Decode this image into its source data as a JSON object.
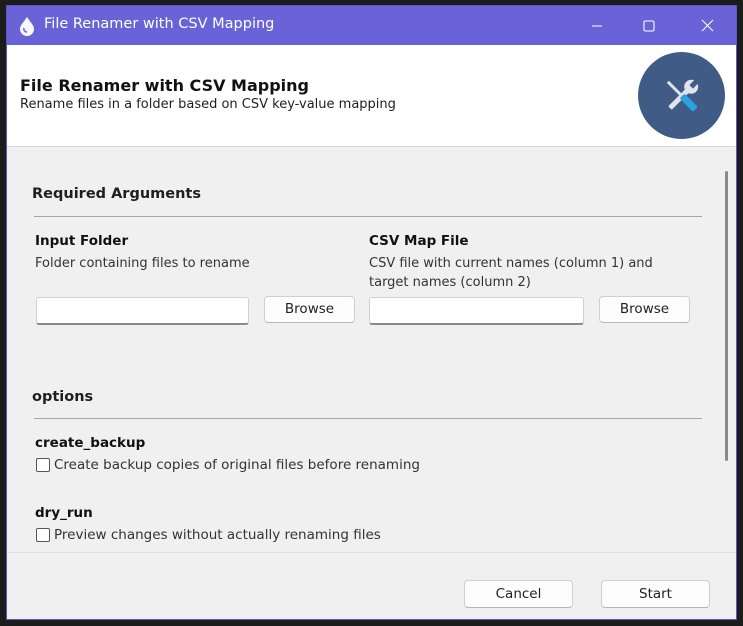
{
  "window": {
    "title": "File Renamer with CSV Mapping",
    "icon": "app-drop-icon",
    "controls": [
      "minimize-icon",
      "maximize-icon",
      "close-icon"
    ]
  },
  "header": {
    "title": "File Renamer with CSV Mapping",
    "subtitle": "Rename files in a folder based on CSV key-value mapping",
    "logo_icon": "tools-icon"
  },
  "required": {
    "section_title": "Required Arguments",
    "input_folder": {
      "label": "Input Folder",
      "description": "Folder containing files to rename",
      "value": "",
      "browse_label": "Browse"
    },
    "csv_map": {
      "label": "CSV Map File",
      "description": "CSV file with current names (column 1) and target names (column 2)",
      "value": "",
      "browse_label": "Browse"
    }
  },
  "options": {
    "section_title": "options",
    "create_backup": {
      "label": "create_backup",
      "checkbox_label": "Create backup copies of original files before renaming",
      "checked": false
    },
    "dry_run": {
      "label": "dry_run",
      "checkbox_label": "Preview changes without actually renaming files",
      "checked": false
    }
  },
  "footer": {
    "cancel_label": "Cancel",
    "start_label": "Start"
  },
  "colors": {
    "titlebar": "#6a63d8",
    "logo_bg": "#3f5b86",
    "window_bg": "#f0f0f0"
  }
}
